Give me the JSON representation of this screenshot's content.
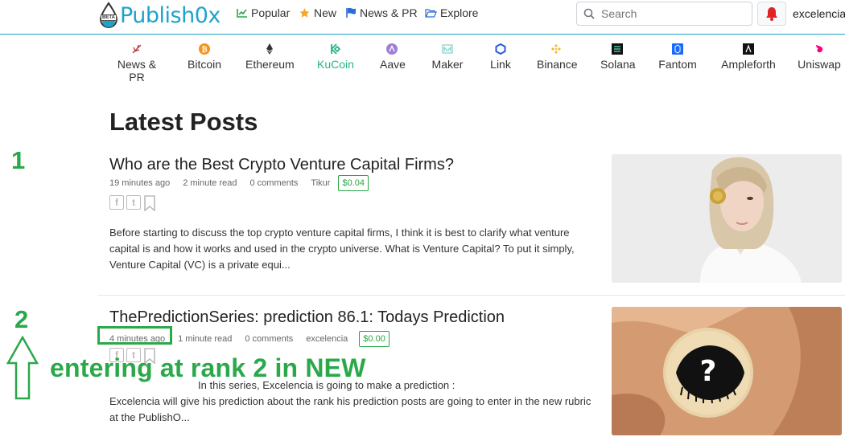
{
  "header": {
    "logo_text": "Publish0x",
    "logo_badge": "BETA",
    "nav": [
      {
        "label": "Popular",
        "icon": "chart-line-icon"
      },
      {
        "label": "New",
        "icon": "star-icon"
      },
      {
        "label": "News & PR",
        "icon": "flag-icon"
      },
      {
        "label": "Explore",
        "icon": "folder-open-icon"
      }
    ],
    "search_placeholder": "Search",
    "username": "excelencia"
  },
  "categories": [
    {
      "label": "News & PR",
      "icon": "news-feather-icon",
      "active": false
    },
    {
      "label": "Bitcoin",
      "icon": "bitcoin-icon",
      "active": false
    },
    {
      "label": "Ethereum",
      "icon": "ethereum-icon",
      "active": false
    },
    {
      "label": "KuCoin",
      "icon": "kucoin-icon",
      "active": true
    },
    {
      "label": "Aave",
      "icon": "aave-icon",
      "active": false
    },
    {
      "label": "Maker",
      "icon": "maker-icon",
      "active": false
    },
    {
      "label": "Link",
      "icon": "chainlink-icon",
      "active": false
    },
    {
      "label": "Binance",
      "icon": "binance-icon",
      "active": false
    },
    {
      "label": "Solana",
      "icon": "solana-icon",
      "active": false
    },
    {
      "label": "Fantom",
      "icon": "fantom-icon",
      "active": false
    },
    {
      "label": "Ampleforth",
      "icon": "ampleforth-icon",
      "active": false
    },
    {
      "label": "Uniswap",
      "icon": "uniswap-icon",
      "active": false
    }
  ],
  "main": {
    "heading": "Latest Posts",
    "posts": [
      {
        "title": "Who are the Best Crypto Venture Capital Firms?",
        "time": "19 minutes ago",
        "read": "2 minute read",
        "comments": "0 comments",
        "author": "Tikur",
        "tip": "$0.04",
        "excerpt": "Before starting to discuss the top crypto venture capital firms, I think it is best to clarify what venture capital is and how it works and used in the crypto universe. What is Venture Capital? To put it simply, Venture Capital (VC) is a private equi..."
      },
      {
        "title": "ThePredictionSeries: prediction 86.1: Todays Prediction",
        "time": "4 minutes ago",
        "read": "1 minute read",
        "comments": "0 comments",
        "author": "excelencia",
        "tip": "$0.00",
        "excerpt_line1": "In this  series, Excelencia is going  to make a  prediction :",
        "excerpt_rest": "Excelencia will give his prediction about the rank his  prediction posts are going to enter in the new rubric at the PublishO..."
      }
    ]
  },
  "annotations": {
    "rank1": "1",
    "rank2": "2",
    "caption": "entering at rank 2 in NEW",
    "color": "#2aa84a"
  },
  "colors": {
    "brand": "#1ea4c9",
    "active": "#28b485",
    "tip": "#28a745"
  }
}
